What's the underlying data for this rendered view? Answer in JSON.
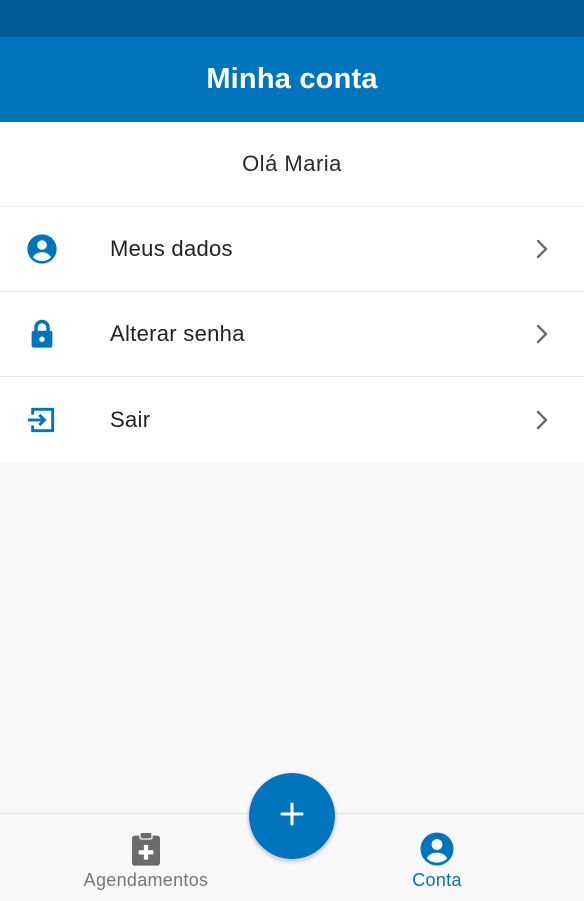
{
  "header": {
    "title": "Minha conta"
  },
  "greeting": "Olá Maria",
  "menu": {
    "items": [
      {
        "label": "Meus dados",
        "icon": "account-circle-icon"
      },
      {
        "label": "Alterar senha",
        "icon": "lock-icon"
      },
      {
        "label": "Sair",
        "icon": "logout-icon"
      }
    ]
  },
  "bottom_nav": {
    "items": [
      {
        "label": "Agendamentos",
        "icon": "clipboard-plus-icon",
        "active": false
      },
      {
        "label": "Conta",
        "icon": "account-circle-icon",
        "active": true
      }
    ],
    "fab_icon": "plus-icon"
  },
  "colors": {
    "primary": "#0075bd",
    "status_bar": "#005a93",
    "background": "#f8f8f8",
    "inactive_icon": "#6b6b6b"
  }
}
